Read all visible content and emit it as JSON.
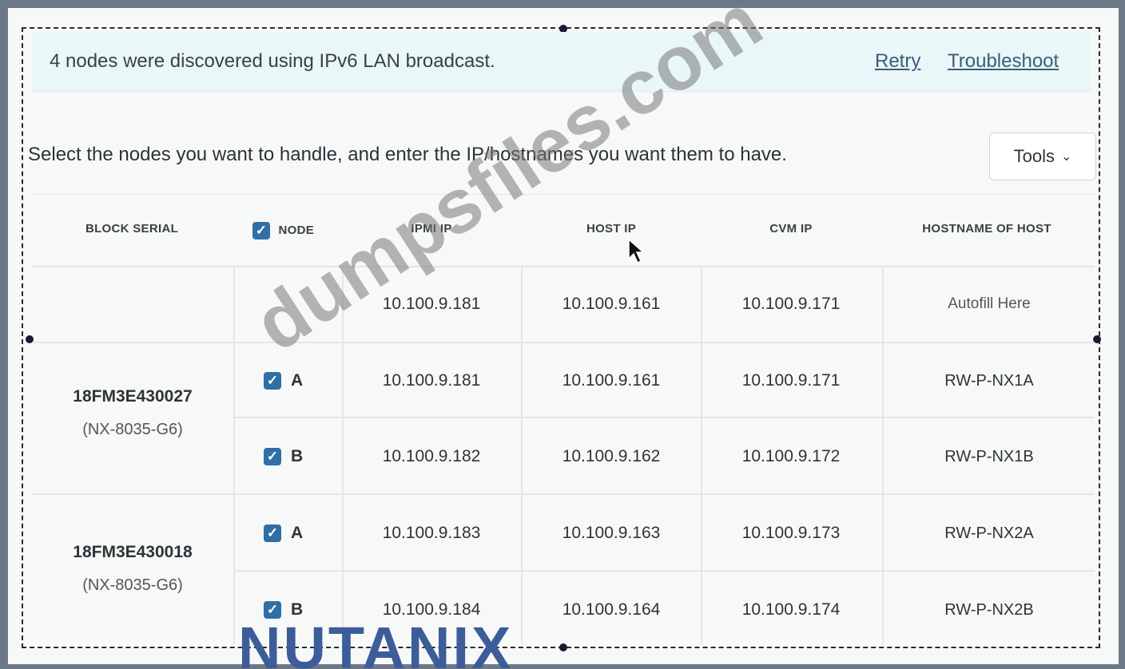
{
  "banner": {
    "message": "4 nodes were discovered using IPv6 LAN broadcast.",
    "retry_label": "Retry",
    "troubleshoot_label": "Troubleshoot"
  },
  "instructions": "Select the nodes you want to handle, and enter the IP/hostnames you want them to have.",
  "tools": {
    "label": "Tools"
  },
  "table": {
    "headers": {
      "block_serial": "BLOCK SERIAL",
      "node": "NODE",
      "ipmi_ip": "IPMI IP",
      "host_ip": "HOST IP",
      "cvm_ip": "CVM IP",
      "hostname": "HOSTNAME OF HOST"
    },
    "autofill_row": {
      "ipmi_ip": "10.100.9.181",
      "host_ip": "10.100.9.161",
      "cvm_ip": "10.100.9.171",
      "hostname": "Autofill Here"
    },
    "blocks": [
      {
        "serial": "18FM3E430027",
        "model": "(NX-8035-G6)",
        "nodes": [
          {
            "node": "A",
            "checked": true,
            "ipmi_ip": "10.100.9.181",
            "host_ip": "10.100.9.161",
            "cvm_ip": "10.100.9.171",
            "hostname": "RW-P-NX1A"
          },
          {
            "node": "B",
            "checked": true,
            "ipmi_ip": "10.100.9.182",
            "host_ip": "10.100.9.162",
            "cvm_ip": "10.100.9.172",
            "hostname": "RW-P-NX1B"
          }
        ]
      },
      {
        "serial": "18FM3E430018",
        "model": "(NX-8035-G6)",
        "nodes": [
          {
            "node": "A",
            "checked": true,
            "ipmi_ip": "10.100.9.183",
            "host_ip": "10.100.9.163",
            "cvm_ip": "10.100.9.173",
            "hostname": "RW-P-NX2A"
          },
          {
            "node": "B",
            "checked": true,
            "ipmi_ip": "10.100.9.184",
            "host_ip": "10.100.9.164",
            "cvm_ip": "10.100.9.174",
            "hostname": "RW-P-NX2B"
          }
        ]
      }
    ]
  },
  "watermark": "dumpsfiles.com",
  "logo": "NUTANIX",
  "icons": {
    "checkbox": "checkbox-checked-icon",
    "chevron": "chevron-down-icon",
    "cursor": "mouse-cursor-icon"
  }
}
